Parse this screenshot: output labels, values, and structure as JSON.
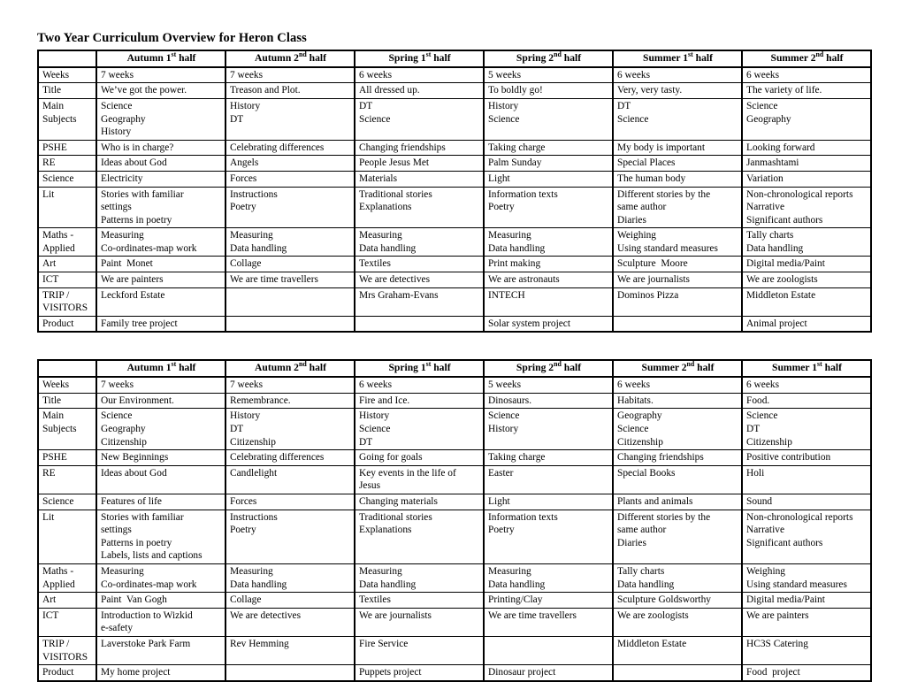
{
  "document": {
    "title": "Two Year Curriculum Overview for Heron Class"
  },
  "tables": [
    {
      "name": "year-a",
      "corner_label": "",
      "headers": [
        {
          "text": "Autumn 1st half",
          "base": "Autumn 1",
          "sup": "st",
          "tail": " half"
        },
        {
          "text": "Autumn 2nd half",
          "base": "Autumn 2",
          "sup": "nd",
          "tail": " half"
        },
        {
          "text": "Spring 1st half",
          "base": "Spring 1",
          "sup": "st",
          "tail": " half"
        },
        {
          "text": "Spring 2nd half",
          "base": "Spring 2",
          "sup": "nd",
          "tail": " half"
        },
        {
          "text": "Summer 1st half",
          "base": "Summer 1",
          "sup": "st",
          "tail": " half"
        },
        {
          "text": "Summer 2nd half",
          "base": "Summer 2",
          "sup": "nd",
          "tail": " half"
        }
      ],
      "rows": [
        {
          "label": "Weeks",
          "cells": [
            "7 weeks",
            "7 weeks",
            "6 weeks",
            "5 weeks",
            "6 weeks",
            "6 weeks"
          ]
        },
        {
          "label": "Title",
          "cells": [
            "We’ve got the power.",
            "Treason and Plot.",
            "All dressed up.",
            "To boldly go!",
            "Very, very tasty.",
            "The variety of life."
          ]
        },
        {
          "label": "Main\nSubjects",
          "cells": [
            "Science\nGeography\nHistory",
            "History\nDT",
            "DT\nScience",
            "History\nScience",
            "DT\nScience",
            "Science\nGeography"
          ]
        },
        {
          "label": "PSHE",
          "cells": [
            "Who is in charge?",
            "Celebrating differences",
            "Changing friendships",
            "Taking charge",
            "My body is important",
            "Looking forward"
          ]
        },
        {
          "label": "RE",
          "cells": [
            "Ideas about God",
            "Angels",
            "People Jesus Met",
            "Palm Sunday",
            "Special Places",
            "Janmashtami"
          ]
        },
        {
          "label": "Science",
          "cells": [
            "Electricity",
            "Forces",
            "Materials",
            "Light",
            "The human body",
            "Variation"
          ]
        },
        {
          "label": "Lit",
          "cells": [
            "Stories with familiar\nsettings\nPatterns in poetry",
            "Instructions\nPoetry",
            "Traditional stories\nExplanations",
            "Information texts\nPoetry",
            "Different stories by the\nsame author\nDiaries",
            "Non-chronological reports\nNarrative\nSignificant authors"
          ]
        },
        {
          "label": "Maths -\nApplied",
          "cells": [
            "Measuring\nCo-ordinates-map work",
            "Measuring\nData handling",
            "Measuring\nData handling",
            "Measuring\nData handling",
            "Weighing\nUsing standard measures",
            "Tally charts\nData handling"
          ]
        },
        {
          "label": "Art",
          "cells": [
            "Paint  Monet",
            "Collage",
            "Textiles",
            "Print making",
            "Sculpture  Moore",
            "Digital media/Paint"
          ]
        },
        {
          "label": "ICT",
          "cells": [
            "We are painters",
            "We are time travellers",
            "We are detectives",
            "We are astronauts",
            "We are journalists",
            "We are zoologists"
          ]
        },
        {
          "label": "TRIP /\nVISITORS",
          "cells": [
            "Leckford Estate",
            "",
            "Mrs Graham-Evans",
            "INTECH",
            "Dominos Pizza",
            "Middleton Estate"
          ]
        },
        {
          "label": "Product",
          "cells": [
            "Family tree project",
            "",
            "",
            "Solar system project",
            "",
            "Animal project"
          ]
        }
      ]
    },
    {
      "name": "year-b",
      "corner_label": "",
      "headers": [
        {
          "text": "Autumn 1st half",
          "base": "Autumn 1",
          "sup": "st",
          "tail": " half"
        },
        {
          "text": "Autumn 2nd half",
          "base": "Autumn 2",
          "sup": "nd",
          "tail": " half"
        },
        {
          "text": "Spring 1st half",
          "base": "Spring 1",
          "sup": "st",
          "tail": " half"
        },
        {
          "text": "Spring 2nd half",
          "base": "Spring 2",
          "sup": "nd",
          "tail": " half"
        },
        {
          "text": "Summer 2nd half",
          "base": "Summer 2",
          "sup": "nd",
          "tail": " half"
        },
        {
          "text": "Summer 1st half",
          "base": "Summer 1",
          "sup": "st",
          "tail": " half"
        }
      ],
      "rows": [
        {
          "label": "Weeks",
          "cells": [
            "7 weeks",
            "7 weeks",
            "6 weeks",
            "5 weeks",
            "6 weeks",
            "6 weeks"
          ]
        },
        {
          "label": "Title",
          "cells": [
            "Our Environment.",
            "Remembrance.",
            "Fire and Ice.",
            "Dinosaurs.",
            "Habitats.",
            "Food."
          ]
        },
        {
          "label": "Main\nSubjects",
          "cells": [
            "Science\nGeography\nCitizenship",
            "History\nDT\nCitizenship",
            "History\nScience\nDT",
            "Science\nHistory",
            "Geography\nScience\nCitizenship",
            "Science\nDT\nCitizenship"
          ]
        },
        {
          "label": "PSHE",
          "cells": [
            "New Beginnings",
            "Celebrating differences",
            "Going for goals",
            "Taking charge",
            "Changing friendships",
            "Positive contribution"
          ]
        },
        {
          "label": "RE",
          "cells": [
            "Ideas about God",
            "Candlelight",
            "Key events in the life of\nJesus",
            "Easter",
            "Special Books",
            "Holi"
          ]
        },
        {
          "label": "Science",
          "cells": [
            "Features of life",
            "Forces",
            "Changing materials",
            "Light",
            "Plants and animals",
            "Sound"
          ]
        },
        {
          "label": "Lit",
          "cells": [
            "Stories with familiar\nsettings\nPatterns in poetry\nLabels, lists and captions",
            "Instructions\nPoetry",
            "Traditional stories\nExplanations",
            "Information texts\nPoetry",
            "Different stories by the\nsame author\nDiaries",
            "Non-chronological reports\nNarrative\nSignificant authors"
          ]
        },
        {
          "label": "Maths -\nApplied",
          "cells": [
            "Measuring\nCo-ordinates-map work",
            "Measuring\nData handling",
            "Measuring\nData handling",
            "Measuring\nData handling",
            "Tally charts\nData handling",
            "Weighing\nUsing standard measures"
          ]
        },
        {
          "label": "Art",
          "cells": [
            "Paint  Van Gogh",
            "Collage",
            "Textiles",
            "Printing/Clay",
            "Sculpture Goldsworthy",
            "Digital media/Paint"
          ]
        },
        {
          "label": "ICT",
          "cells": [
            "Introduction to Wizkid\ne-safety",
            "We are detectives",
            "We are journalists",
            "We are time travellers",
            "We are zoologists",
            "We are painters"
          ]
        },
        {
          "label": "TRIP /\nVISITORS",
          "cells": [
            "Laverstoke Park Farm",
            "Rev Hemming",
            "Fire Service",
            "",
            "Middleton Estate",
            "HC3S Catering"
          ]
        },
        {
          "label": "Product",
          "cells": [
            "My home project",
            "",
            "Puppets project",
            "Dinosaur project",
            "",
            "Food  project"
          ]
        }
      ]
    }
  ]
}
